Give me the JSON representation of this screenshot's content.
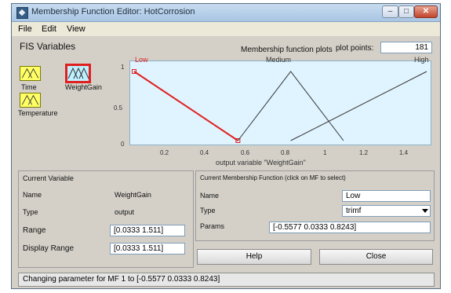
{
  "window": {
    "title": "Membership Function Editor: HotCorrosion",
    "minimize_glyph": "–",
    "maximize_glyph": "□",
    "close_glyph": "✕"
  },
  "menu": {
    "file": "File",
    "edit": "Edit",
    "view": "View"
  },
  "fis_variables": {
    "header": "FIS Variables",
    "inputs": [
      {
        "label": "Time"
      },
      {
        "label": "Temperature"
      }
    ],
    "output": {
      "label": "WeightGain"
    }
  },
  "plot": {
    "header": "Membership function plots",
    "plot_points_label": "plot points:",
    "plot_points_value": "181",
    "mf_labels": {
      "low": "Low",
      "medium": "Medium",
      "high": "High"
    },
    "y_ticks": [
      "1",
      "0.5",
      "0"
    ],
    "x_ticks": [
      "0.2",
      "0.4",
      "0.6",
      "0.8",
      "1",
      "1.2",
      "1.4"
    ],
    "xlabel": "output variable \"WeightGain\""
  },
  "chart_data": {
    "type": "line",
    "xlim": [
      0.0333,
      1.511
    ],
    "ylim": [
      0,
      1
    ],
    "series": [
      {
        "name": "Low",
        "selected": true,
        "color": "#e02020",
        "points": [
          [
            0.0333,
            1
          ],
          [
            0.0333,
            1
          ],
          [
            0.5577,
            0
          ]
        ]
      },
      {
        "name": "Medium",
        "selected": false,
        "color": "#333333",
        "points": [
          [
            0.5577,
            0
          ],
          [
            0.8243,
            1
          ],
          [
            1.0909,
            0
          ]
        ]
      },
      {
        "name": "High",
        "selected": false,
        "color": "#333333",
        "points": [
          [
            0.8243,
            0
          ],
          [
            1.511,
            1
          ],
          [
            1.511,
            1
          ]
        ]
      }
    ]
  },
  "current_variable": {
    "header": "Current Variable",
    "name_label": "Name",
    "name_value": "WeightGain",
    "type_label": "Type",
    "type_value": "output",
    "range_label": "Range",
    "range_value": "[0.0333 1.511]",
    "display_range_label": "Display Range",
    "display_range_value": "[0.0333 1.511]"
  },
  "current_mf": {
    "header": "Current Membership Function (click on MF to select)",
    "name_label": "Name",
    "name_value": "Low",
    "type_label": "Type",
    "type_value": "trimf",
    "params_label": "Params",
    "params_value": "[-0.5577 0.0333 0.8243]"
  },
  "buttons": {
    "help": "Help",
    "close": "Close"
  },
  "status": "Changing parameter for MF 1 to [-0.5577 0.0333 0.8243]"
}
